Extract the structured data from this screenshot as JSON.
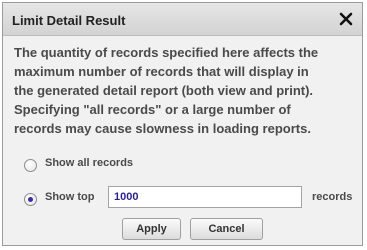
{
  "dialog": {
    "title": "Limit Detail Result",
    "message": "The quantity of records specified here affects the\nmaximum number of records that will display in\nthe generated detail report (both view and print).\nSpecifying \"all records\" or a large number of\nrecords may cause slowness in loading reports.",
    "options": {
      "all_label": "Show all records",
      "all_selected": false,
      "top_label": "Show top",
      "top_selected": true,
      "top_value": "1000",
      "records_suffix": "records"
    },
    "buttons": {
      "apply": "Apply",
      "cancel": "Cancel"
    },
    "colors": {
      "selected_radio": "#3a2ea8",
      "input_text": "#2a1f9c"
    },
    "icons": {
      "close": "close-icon"
    }
  }
}
